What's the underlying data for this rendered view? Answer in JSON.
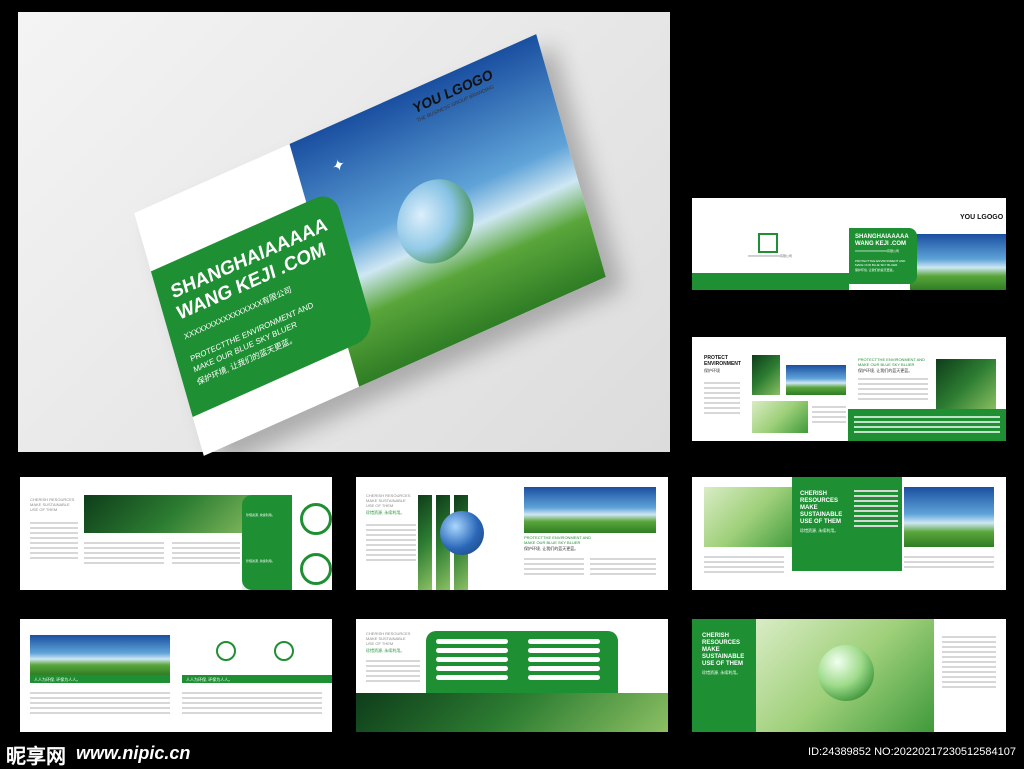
{
  "hero": {
    "brand": "YOU LGOGO",
    "brand_tag": "THE BUSINESS GROUP BRANDING",
    "title_line1": "SHANGHAIAAAAA",
    "title_line2": "WANG KEJI .COM",
    "company": "XXXXXXXXXXXXXXXX有限公司",
    "slogan_line1": "PROTECTTHE ENVIRONMENT AND",
    "slogan_line2": "MAKE OUR BLUE SKY BLUER",
    "slogan_cn": "保护环境, 让我们的蓝天更蓝。"
  },
  "thumbs": {
    "t1": {
      "brand": "YOU LGOGO",
      "title_line1": "SHANGHAIAAAAA",
      "title_line2": "WANG KEJI .COM",
      "company": "XXXXXXXXXXXXXXXX有限公司",
      "slogan": "PROTECTTHE ENVIRONMENT AND MAKE OUR BLUE SKY BLUER",
      "slogan_cn": "保护环境, 让我们的蓝天更蓝。"
    },
    "t2": {
      "heading_line1": "PROTECT",
      "heading_line2": "ENVIRONMENT",
      "heading_cn": "保护环境",
      "right_heading": "PROTECTTHE ENVIRONMENT AND",
      "right_heading2": "MAKE OUR BLUE SKY BLUER",
      "right_cn": "保护环境, 让我们的蓝天更蓝。"
    },
    "t3": {
      "heading_line1": "CHERISH RESOURCES",
      "heading_line2": "MAKE SUSTAINABLE",
      "heading_line3": "USE OF THEM",
      "side_cn1": "珍惜资源, 永续利用。",
      "side_cn2": "珍惜资源, 永续利用。"
    },
    "t4": {
      "heading_line1": "CHERISH RESOURCES",
      "heading_line2": "MAKE SUSTAINABLE",
      "heading_line3": "USE OF THEM",
      "heading_cn": "珍惜资源, 永续利用。",
      "caption": "PROTECTTHE ENVIRONMENT AND",
      "caption2": "MAKE OUR BLUE SKY BLUER",
      "caption_cn": "保护环境, 让我们的蓝天更蓝。"
    },
    "t5": {
      "heading_line1": "CHERISH",
      "heading_line2": "RESOURCES",
      "heading_line3": "MAKE",
      "heading_line4": "SUSTAINABLE",
      "heading_line5": "USE OF THEM",
      "heading_cn": "珍惜资源, 永续利用。"
    },
    "t6": {
      "band_left": "人人为环保, 环保为人人。",
      "band_right": "人人为环保, 环保为人人。"
    },
    "t7": {
      "heading_line1": "CHERISH RESOURCES",
      "heading_line2": "MAKE SUSTAINABLE",
      "heading_line3": "USE OF THEM",
      "heading_cn": "珍惜资源, 永续利用。"
    },
    "t8": {
      "heading_line1": "CHERISH",
      "heading_line2": "RESOURCES",
      "heading_line3": "MAKE",
      "heading_line4": "SUSTAINABLE",
      "heading_line5": "USE OF THEM",
      "heading_cn": "珍惜资源, 永续利用。"
    }
  },
  "footer": {
    "watermark_cn": "昵享网",
    "watermark_url": "www.nipic.cn",
    "image_id": "ID:24389852 NO:20220217230512584107"
  },
  "colors": {
    "accent_green": "#1f8f34",
    "background": "#000000"
  }
}
